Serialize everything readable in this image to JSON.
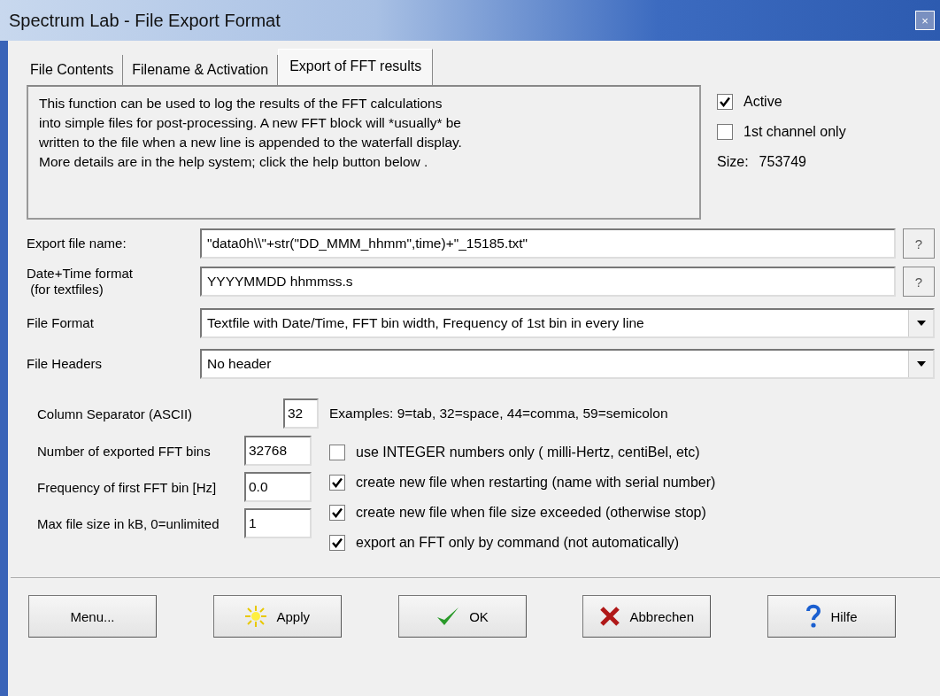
{
  "window": {
    "title": "Spectrum Lab  -  File Export Format",
    "close": "×"
  },
  "tabs": [
    {
      "label": "File Contents",
      "selected": false
    },
    {
      "label": "Filename & Activation",
      "selected": false
    },
    {
      "label": "Export of FFT results",
      "selected": true
    }
  ],
  "info": "This function can be used to log the results of the FFT calculations\ninto simple files for post-processing. A new FFT block will *usually* be\nwritten to the file when a new line is appended to the waterfall display.\nMore details are in the help system; click the help button below .",
  "side_options": [
    {
      "label": "Active",
      "checked": true
    },
    {
      "label": "1st channel only",
      "checked": false
    }
  ],
  "size": {
    "label": "Size:",
    "value": "753749"
  },
  "fields": [
    {
      "kind": "text",
      "label": "Export file name:",
      "value": "\"data0h\\\\\"+str(\"DD_MMM_hhmm\",time)+\"_15185.txt\"",
      "help": "?"
    },
    {
      "kind": "text",
      "label": "Date+Time format\n (for textfiles)",
      "value": "YYYYMMDD hhmmss.s",
      "help": "?"
    },
    {
      "kind": "select",
      "label": "File Format",
      "value": "Textfile with Date/Time, FFT bin width, Frequency of 1st bin in every line"
    },
    {
      "kind": "select",
      "label": "File Headers",
      "value": "No header"
    }
  ],
  "separator": {
    "label": "Column Separator (ASCII)",
    "value": "32",
    "examples": "Examples: 9=tab, 32=space, 44=comma, 59=semicolon"
  },
  "numeric_fields": [
    {
      "label": "Number of exported FFT bins",
      "value": "32768"
    },
    {
      "label": "Frequency of first FFT bin [Hz]",
      "value": "0.0"
    },
    {
      "label": "Max file size in kB, 0=unlimited",
      "value": "1"
    }
  ],
  "options": [
    {
      "label": "use INTEGER numbers only ( milli-Hertz, centiBel, etc)",
      "checked": false
    },
    {
      "label": "create new file when restarting (name with serial number)",
      "checked": true
    },
    {
      "label": "create new file when file size exceeded (otherwise stop)",
      "checked": true
    },
    {
      "label": "export an FFT only by command (not automatically)",
      "checked": true
    }
  ],
  "buttons": [
    {
      "kind": "menu",
      "label": "Menu..."
    },
    {
      "kind": "apply",
      "label": "Apply"
    },
    {
      "kind": "ok",
      "label": "OK"
    },
    {
      "kind": "cancel",
      "label": "Abbrechen"
    },
    {
      "kind": "help",
      "label": "Hilfe"
    }
  ]
}
